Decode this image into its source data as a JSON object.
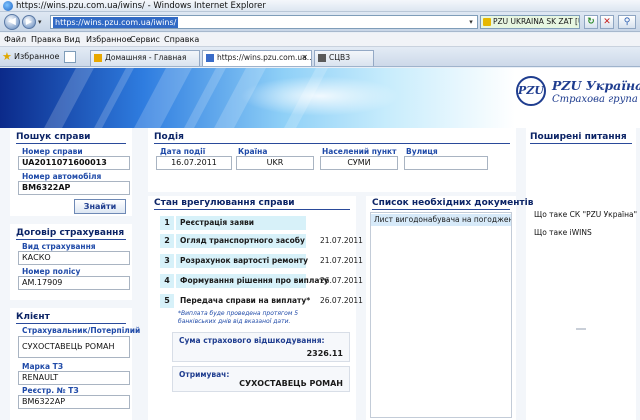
{
  "browser": {
    "window_title": "https://wins.pzu.com.ua/iwins/ - Windows Internet Explorer",
    "url": "https://wins.pzu.com.ua/iwins/",
    "cert_label": "PZU UKRAINA SK ZAT [UA]",
    "menu": [
      "Файл",
      "Правка",
      "Вид",
      "Избранное",
      "Сервис",
      "Справка"
    ],
    "favorites_label": "Избранное",
    "tabs": [
      {
        "label": "Домашняя - Главная"
      },
      {
        "label": "https://wins.pzu.com.ua..."
      },
      {
        "label": "СЦВЗ"
      }
    ]
  },
  "brand": {
    "logo_mark": "PZU",
    "name": "PZU Україна",
    "tagline": "Страхова група"
  },
  "search": {
    "title": "Пошук справи",
    "case_number_label": "Номер справи",
    "case_number": "UA2011071600013",
    "car_number_label": "Номер автомобіля",
    "car_number": "BM6322AP",
    "find_button": "Знайти"
  },
  "contract": {
    "title": "Договір страхування",
    "type_label": "Вид страхування",
    "type_value": "КАСКО",
    "policy_label": "Номер полісу",
    "policy_value": "AM.17909"
  },
  "client": {
    "title": "Клієнт",
    "insured_label": "Страхувальник/Потерпілий",
    "insured_value": "СУХОСТАВЕЦЬ РОМАН",
    "make_label": "Марка ТЗ",
    "make_value": "RENAULT",
    "reg_label": "Реєстр. № ТЗ",
    "reg_value": "BM6322AP"
  },
  "event": {
    "title": "Подія",
    "date_label": "Дата події",
    "date_value": "16.07.2011",
    "country_label": "Країна",
    "country_value": "UKR",
    "city_label": "Населений пункт",
    "city_value": "СУМИ",
    "street_label": "Вулиця",
    "street_value": ""
  },
  "status": {
    "title": "Стан врегулювання справи",
    "steps": [
      {
        "num": "1",
        "label": "Реєстрація заяви",
        "date": ""
      },
      {
        "num": "2",
        "label": "Огляд транспортного засобу",
        "date": "21.07.2011"
      },
      {
        "num": "3",
        "label": "Розрахунок вартості ремонту",
        "date": "21.07.2011"
      },
      {
        "num": "4",
        "label": "Формування рішення про виплату",
        "date": "26.07.2011"
      },
      {
        "num": "5",
        "label": "Передача справи на виплату*",
        "date": "26.07.2011"
      }
    ],
    "note": "*Виплата буде проведена протягом 5 банківських днів від вказаної дати.",
    "sum_label": "Сума страхового відшкодування:",
    "sum_value": "2326.11",
    "recipient_label": "Отримувач:",
    "recipient_value": "СУХОСТАВЕЦЬ РОМАН"
  },
  "docs": {
    "title": "Список необхідних документів",
    "items": [
      "Лист вигодонабувача на погодження..."
    ]
  },
  "faq": {
    "title": "Поширені питання",
    "items": [
      "Що таке СК \"PZU Україна\"",
      "Що таке iWINS"
    ]
  }
}
